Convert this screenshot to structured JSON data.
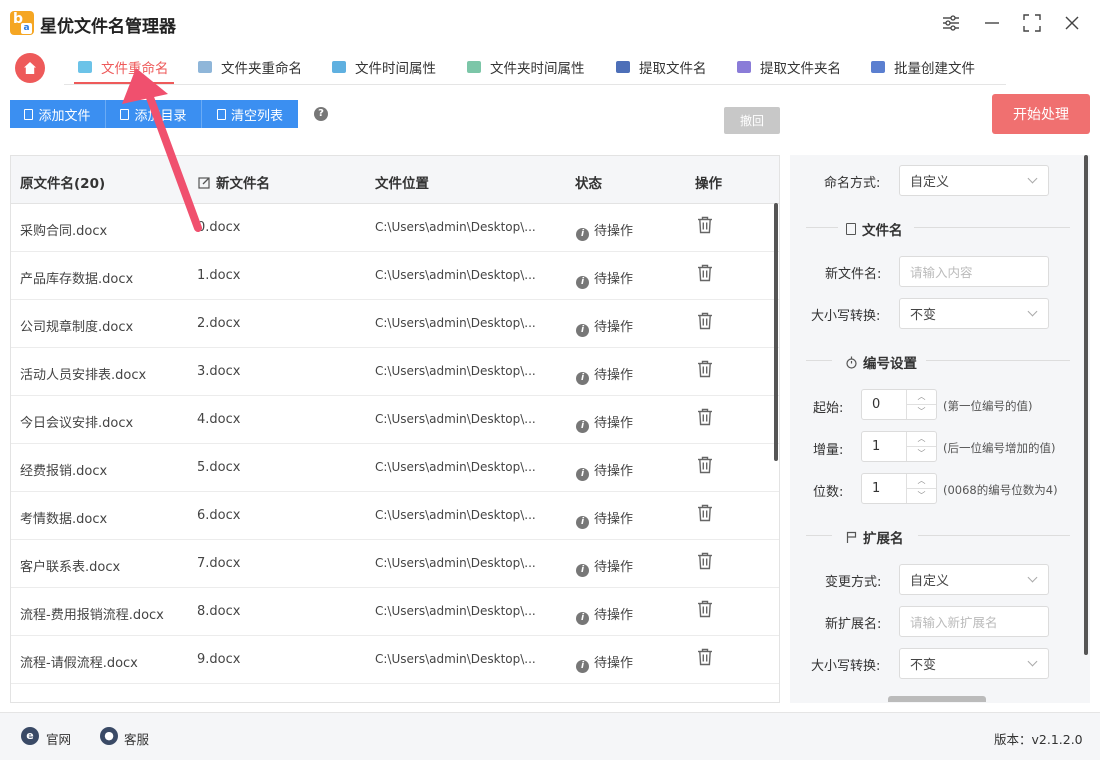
{
  "app": {
    "title": "星优文件名管理器"
  },
  "window": {
    "settings": "⚙",
    "minimize": "—",
    "maximize": "⛶",
    "close": "✕"
  },
  "tabs": [
    {
      "label": "文件重命名",
      "active": true
    },
    {
      "label": "文件夹重命名"
    },
    {
      "label": "文件时间属性"
    },
    {
      "label": "文件夹时间属性"
    },
    {
      "label": "提取文件名"
    },
    {
      "label": "提取文件夹名"
    },
    {
      "label": "批量创建文件"
    }
  ],
  "toolbar": {
    "add_file": "添加文件",
    "add_dir": "添加目录",
    "clear_list": "清空列表",
    "help": "?",
    "undo": "撤回",
    "start": "开始处理"
  },
  "table": {
    "headers": {
      "original": "原文件名(20)",
      "new": "新文件名",
      "location": "文件位置",
      "status": "状态",
      "action": "操作"
    },
    "rows": [
      {
        "original": "采购合同.docx",
        "new": "0.docx",
        "location": "C:\\Users\\admin\\Desktop\\...",
        "status": "待操作"
      },
      {
        "original": "产品库存数据.docx",
        "new": "1.docx",
        "location": "C:\\Users\\admin\\Desktop\\...",
        "status": "待操作"
      },
      {
        "original": "公司规章制度.docx",
        "new": "2.docx",
        "location": "C:\\Users\\admin\\Desktop\\...",
        "status": "待操作"
      },
      {
        "original": "活动人员安排表.docx",
        "new": "3.docx",
        "location": "C:\\Users\\admin\\Desktop\\...",
        "status": "待操作"
      },
      {
        "original": "今日会议安排.docx",
        "new": "4.docx",
        "location": "C:\\Users\\admin\\Desktop\\...",
        "status": "待操作"
      },
      {
        "original": "经费报销.docx",
        "new": "5.docx",
        "location": "C:\\Users\\admin\\Desktop\\...",
        "status": "待操作"
      },
      {
        "original": "考情数据.docx",
        "new": "6.docx",
        "location": "C:\\Users\\admin\\Desktop\\...",
        "status": "待操作"
      },
      {
        "original": "客户联系表.docx",
        "new": "7.docx",
        "location": "C:\\Users\\admin\\Desktop\\...",
        "status": "待操作"
      },
      {
        "original": "流程-费用报销流程.docx",
        "new": "8.docx",
        "location": "C:\\Users\\admin\\Desktop\\...",
        "status": "待操作"
      },
      {
        "original": "流程-请假流程.docx",
        "new": "9.docx",
        "location": "C:\\Users\\admin\\Desktop\\...",
        "status": "待操作"
      }
    ]
  },
  "panel": {
    "naming_mode_label": "命名方式:",
    "naming_mode_value": "自定义",
    "section_filename": "文件名",
    "new_name_label": "新文件名:",
    "new_name_placeholder": "请输入内容",
    "case_label": "大小写转换:",
    "case_value": "不变",
    "section_numbering": "编号设置",
    "start_label": "起始:",
    "start_value": "0",
    "start_hint": "(第一位编号的值)",
    "step_label": "增量:",
    "step_value": "1",
    "step_hint": "(后一位编号增加的值)",
    "digits_label": "位数:",
    "digits_value": "1",
    "digits_hint": "(0068的编号位数为4)",
    "section_ext": "扩展名",
    "ext_mode_label": "变更方式:",
    "ext_mode_value": "自定义",
    "new_ext_label": "新扩展名:",
    "new_ext_placeholder": "请输入新扩展名",
    "ext_case_label": "大小写转换:",
    "ext_case_value": "不变"
  },
  "footer": {
    "website": "官网",
    "support": "客服",
    "version": "版本：v2.1.2.0"
  },
  "colors": {
    "accent": "#ee5a5a",
    "primary": "#3b8ff1",
    "start": "#f07070"
  }
}
